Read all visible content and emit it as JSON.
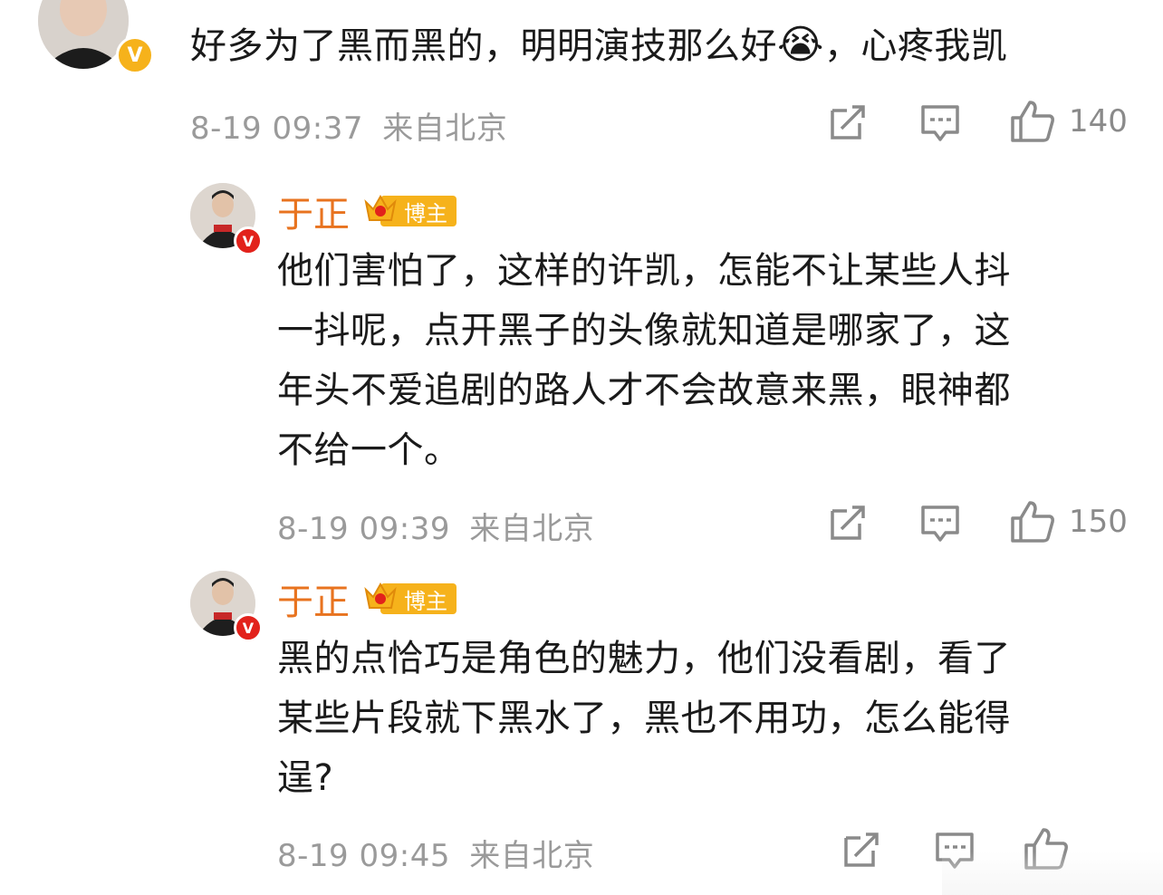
{
  "comments": [
    {
      "text": "好多为了黑而黑的，明明演技那么好😭，心疼我凯",
      "text_main": "好多为了黑而黑的，明明演技那么好",
      "emoji": "😭",
      "text_tail": "，心疼我凯",
      "time": "8-19 09:37",
      "location": "来自北京",
      "likes": "140"
    }
  ],
  "replies": [
    {
      "author": "于正",
      "tag": "博主",
      "lines": [
        "他们害怕了，这样的许凯，怎能不让某些人抖",
        "一抖呢，点开黑子的头像就知道是哪家了，这",
        "年头不爱追剧的路人才不会故意来黑，眼神都",
        "不给一个。"
      ],
      "time": "8-19 09:39",
      "location": "来自北京",
      "likes": "150"
    },
    {
      "author": "于正",
      "tag": "博主",
      "lines": [
        "黑的点恰巧是角色的魅力，他们没看剧，看了",
        "某些片段就下黑水了，黑也不用功，怎么能得",
        "逞?"
      ],
      "time": "8-19 09:45",
      "location": "来自北京",
      "likes": ""
    }
  ],
  "icons": {
    "share": "share-icon",
    "comment": "comment-icon",
    "like": "like-icon"
  },
  "colors": {
    "author_name": "#e8731f",
    "badge_gold": "#f6b21b",
    "badge_red": "#e2221b",
    "meta_gray": "#9a9a9a"
  }
}
